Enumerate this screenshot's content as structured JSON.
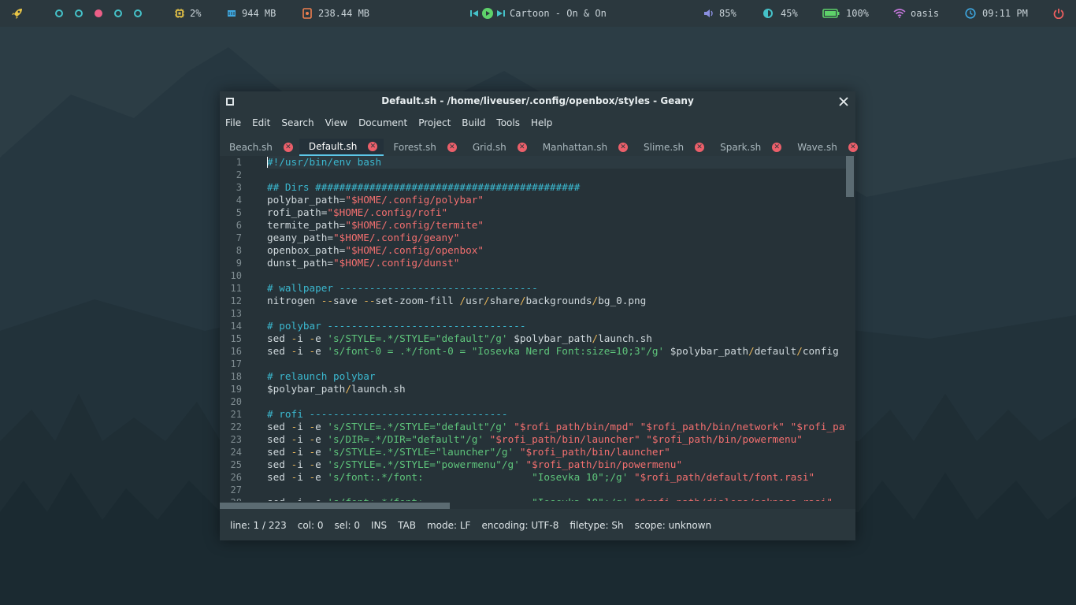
{
  "topbar": {
    "cpu": "2%",
    "memory": "944 MB",
    "disk": "238.44 MB",
    "now_playing": "Cartoon - On & On",
    "volume": "85%",
    "brightness": "45%",
    "battery": "100%",
    "wifi": "oasis",
    "clock": "09:11 PM",
    "workspaces": [
      {
        "active": false
      },
      {
        "active": false
      },
      {
        "active": true
      },
      {
        "active": false
      },
      {
        "active": false
      }
    ],
    "icons": [
      "rocket-icon",
      "cpu-icon",
      "memory-icon",
      "disk-icon",
      "prev-icon",
      "play-icon",
      "next-icon",
      "volume-icon",
      "brightness-icon",
      "battery-icon",
      "wifi-icon",
      "clock-icon",
      "power-icon"
    ],
    "colors": {
      "accent": "#45c2c9",
      "active_workspace": "#ec5f87",
      "icon_yellow": "#e8c547",
      "battery": "#5ed16a",
      "wifi": "#c678dd",
      "power": "#ef5f5f"
    }
  },
  "window": {
    "title": "Default.sh - /home/liveuser/.config/openbox/styles - Geany",
    "menu": [
      "File",
      "Edit",
      "Search",
      "View",
      "Document",
      "Project",
      "Build",
      "Tools",
      "Help"
    ],
    "tabs": [
      "Beach.sh",
      "Default.sh",
      "Forest.sh",
      "Grid.sh",
      "Manhattan.sh",
      "Slime.sh",
      "Spark.sh",
      "Wave.sh"
    ],
    "active_tab": "Default.sh",
    "status": {
      "line": "line: 1 / 223",
      "col": "col: 0",
      "sel": "sel: 0",
      "ins": "INS",
      "tab": "TAB",
      "mode": "mode: LF",
      "encoding": "encoding: UTF-8",
      "filetype": "filetype: Sh",
      "scope": "scope: unknown"
    }
  },
  "editor": {
    "lines": [
      [
        [
          "c",
          "#!/usr/bin/env bash"
        ]
      ],
      [],
      [
        [
          "c",
          "## Dirs ############################################"
        ]
      ],
      [
        [
          "p",
          "polybar_path="
        ],
        [
          "s",
          "\"$HOME/.config/polybar\""
        ]
      ],
      [
        [
          "p",
          "rofi_path="
        ],
        [
          "s",
          "\"$HOME/.config/rofi\""
        ]
      ],
      [
        [
          "p",
          "termite_path="
        ],
        [
          "s",
          "\"$HOME/.config/termite\""
        ]
      ],
      [
        [
          "p",
          "geany_path="
        ],
        [
          "s",
          "\"$HOME/.config/geany\""
        ]
      ],
      [
        [
          "p",
          "openbox_path="
        ],
        [
          "s",
          "\"$HOME/.config/openbox\""
        ]
      ],
      [
        [
          "p",
          "dunst_path="
        ],
        [
          "s",
          "\"$HOME/.config/dunst\""
        ]
      ],
      [],
      [
        [
          "c",
          "# wallpaper ---------------------------------"
        ]
      ],
      [
        [
          "p",
          "nitrogen "
        ],
        [
          "o",
          "--"
        ],
        [
          "p",
          "save "
        ],
        [
          "o",
          "--"
        ],
        [
          "p",
          "set-zoom-fill "
        ],
        [
          "o",
          "/"
        ],
        [
          "p",
          "usr"
        ],
        [
          "o",
          "/"
        ],
        [
          "p",
          "share"
        ],
        [
          "o",
          "/"
        ],
        [
          "p",
          "backgrounds"
        ],
        [
          "o",
          "/"
        ],
        [
          "p",
          "bg_0.png"
        ]
      ],
      [],
      [
        [
          "c",
          "# polybar ---------------------------------"
        ]
      ],
      [
        [
          "p",
          "sed "
        ],
        [
          "o",
          "-"
        ],
        [
          "p",
          "i "
        ],
        [
          "o",
          "-"
        ],
        [
          "p",
          "e "
        ],
        [
          "q",
          "'s/STYLE=.*/STYLE=\"default\"/g'"
        ],
        [
          "p",
          " $polybar_path"
        ],
        [
          "o",
          "/"
        ],
        [
          "p",
          "launch.sh"
        ]
      ],
      [
        [
          "p",
          "sed "
        ],
        [
          "o",
          "-"
        ],
        [
          "p",
          "i "
        ],
        [
          "o",
          "-"
        ],
        [
          "p",
          "e "
        ],
        [
          "q",
          "'s/font-0 = .*/font-0 = \"Iosevka Nerd Font:size=10;3\"/g'"
        ],
        [
          "p",
          " $polybar_path"
        ],
        [
          "o",
          "/"
        ],
        [
          "p",
          "default"
        ],
        [
          "o",
          "/"
        ],
        [
          "p",
          "config"
        ]
      ],
      [],
      [
        [
          "c",
          "# relaunch polybar"
        ]
      ],
      [
        [
          "p",
          "$polybar_path"
        ],
        [
          "o",
          "/"
        ],
        [
          "p",
          "launch.sh"
        ]
      ],
      [],
      [
        [
          "c",
          "# rofi ---------------------------------"
        ]
      ],
      [
        [
          "p",
          "sed "
        ],
        [
          "o",
          "-"
        ],
        [
          "p",
          "i "
        ],
        [
          "o",
          "-"
        ],
        [
          "p",
          "e "
        ],
        [
          "q",
          "'s/STYLE=.*/STYLE=\"default\"/g'"
        ],
        [
          "p",
          " "
        ],
        [
          "s",
          "\"$rofi_path/bin/mpd\""
        ],
        [
          "p",
          " "
        ],
        [
          "s",
          "\"$rofi_path/bin/network\""
        ],
        [
          "p",
          " "
        ],
        [
          "s",
          "\"$rofi_path/bin/"
        ]
      ],
      [
        [
          "p",
          "sed "
        ],
        [
          "o",
          "-"
        ],
        [
          "p",
          "i "
        ],
        [
          "o",
          "-"
        ],
        [
          "p",
          "e "
        ],
        [
          "q",
          "'s/DIR=.*/DIR=\"default\"/g'"
        ],
        [
          "p",
          " "
        ],
        [
          "s",
          "\"$rofi_path/bin/launcher\""
        ],
        [
          "p",
          " "
        ],
        [
          "s",
          "\"$rofi_path/bin/powermenu\""
        ]
      ],
      [
        [
          "p",
          "sed "
        ],
        [
          "o",
          "-"
        ],
        [
          "p",
          "i "
        ],
        [
          "o",
          "-"
        ],
        [
          "p",
          "e "
        ],
        [
          "q",
          "'s/STYLE=.*/STYLE=\"launcher\"/g'"
        ],
        [
          "p",
          " "
        ],
        [
          "s",
          "\"$rofi_path/bin/launcher\""
        ]
      ],
      [
        [
          "p",
          "sed "
        ],
        [
          "o",
          "-"
        ],
        [
          "p",
          "i "
        ],
        [
          "o",
          "-"
        ],
        [
          "p",
          "e "
        ],
        [
          "q",
          "'s/STYLE=.*/STYLE=\"powermenu\"/g'"
        ],
        [
          "p",
          " "
        ],
        [
          "s",
          "\"$rofi_path/bin/powermenu\""
        ]
      ],
      [
        [
          "p",
          "sed "
        ],
        [
          "o",
          "-"
        ],
        [
          "p",
          "i "
        ],
        [
          "o",
          "-"
        ],
        [
          "p",
          "e "
        ],
        [
          "q",
          "'s/font:.*/font:                  \"Iosevka 10\";/g'"
        ],
        [
          "p",
          " "
        ],
        [
          "s",
          "\"$rofi_path/default/font.rasi\""
        ]
      ],
      [],
      [
        [
          "p",
          "sed "
        ],
        [
          "o",
          "-"
        ],
        [
          "p",
          "i "
        ],
        [
          "o",
          "-"
        ],
        [
          "p",
          "e "
        ],
        [
          "q",
          "'s/font:.*/font:                  \"Iosevka 10\";/g'"
        ],
        [
          "p",
          " "
        ],
        [
          "s",
          "\"$rofi_path/dialogs/askpass.rasi\""
        ]
      ]
    ],
    "start_line": 1
  }
}
